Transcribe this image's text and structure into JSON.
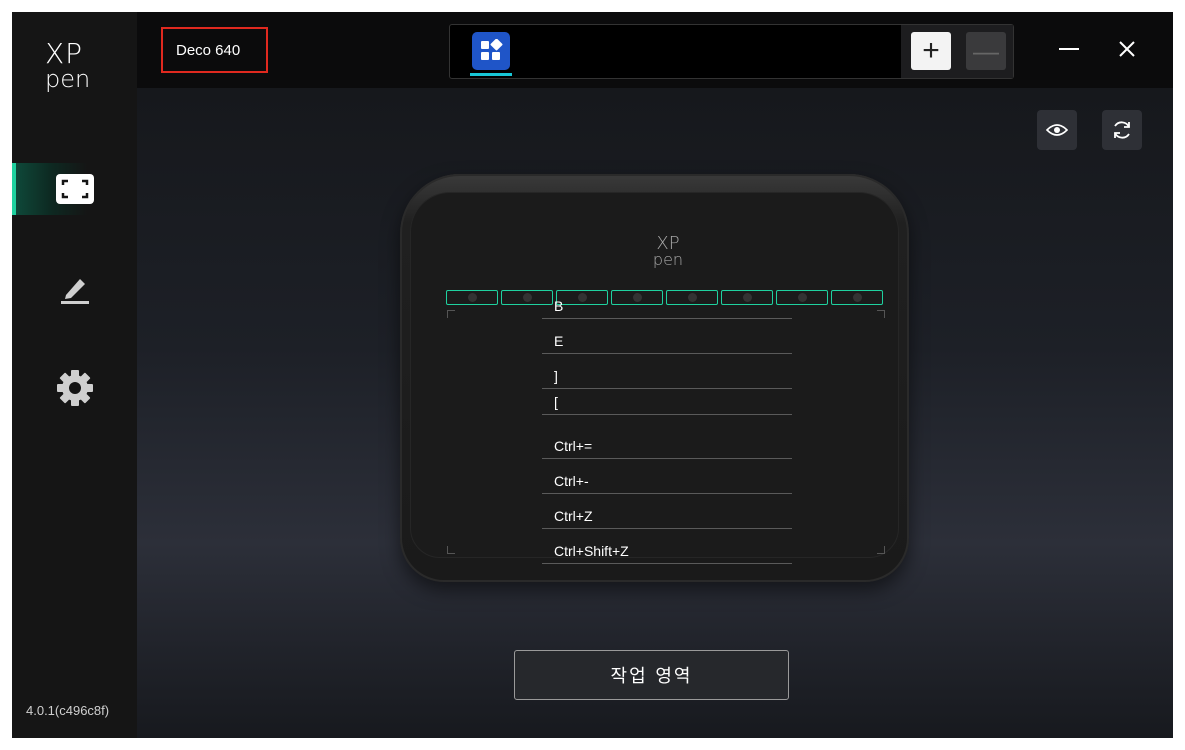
{
  "sidebar": {
    "logo": {
      "top": "XP",
      "bottom": "pen"
    },
    "items": [
      {
        "name": "work-area",
        "icon": "fullscreen-icon",
        "active": true
      },
      {
        "name": "pen",
        "icon": "pen-icon",
        "active": false
      },
      {
        "name": "settings",
        "icon": "gear-icon",
        "active": false
      }
    ],
    "version": "4.0.1(c496c8f)"
  },
  "topbar": {
    "device_name": "Deco 640",
    "app_tab_icon": "apps-grid-icon",
    "add_label": "+",
    "remove_label": "—"
  },
  "tablet": {
    "logo_top": "XP",
    "logo_bottom": "pen",
    "hardware_key_count": 8
  },
  "shortcuts": [
    "B",
    "E",
    "]",
    "[",
    "Ctrl+=",
    "Ctrl+-",
    "Ctrl+Z",
    "Ctrl+Shift+Z"
  ],
  "main": {
    "work_area_button": "작업 영역"
  },
  "colors": {
    "accent": "#1fd19f",
    "highlight_box": "#e0291f",
    "app_icon_bg": "#1f55c8"
  }
}
